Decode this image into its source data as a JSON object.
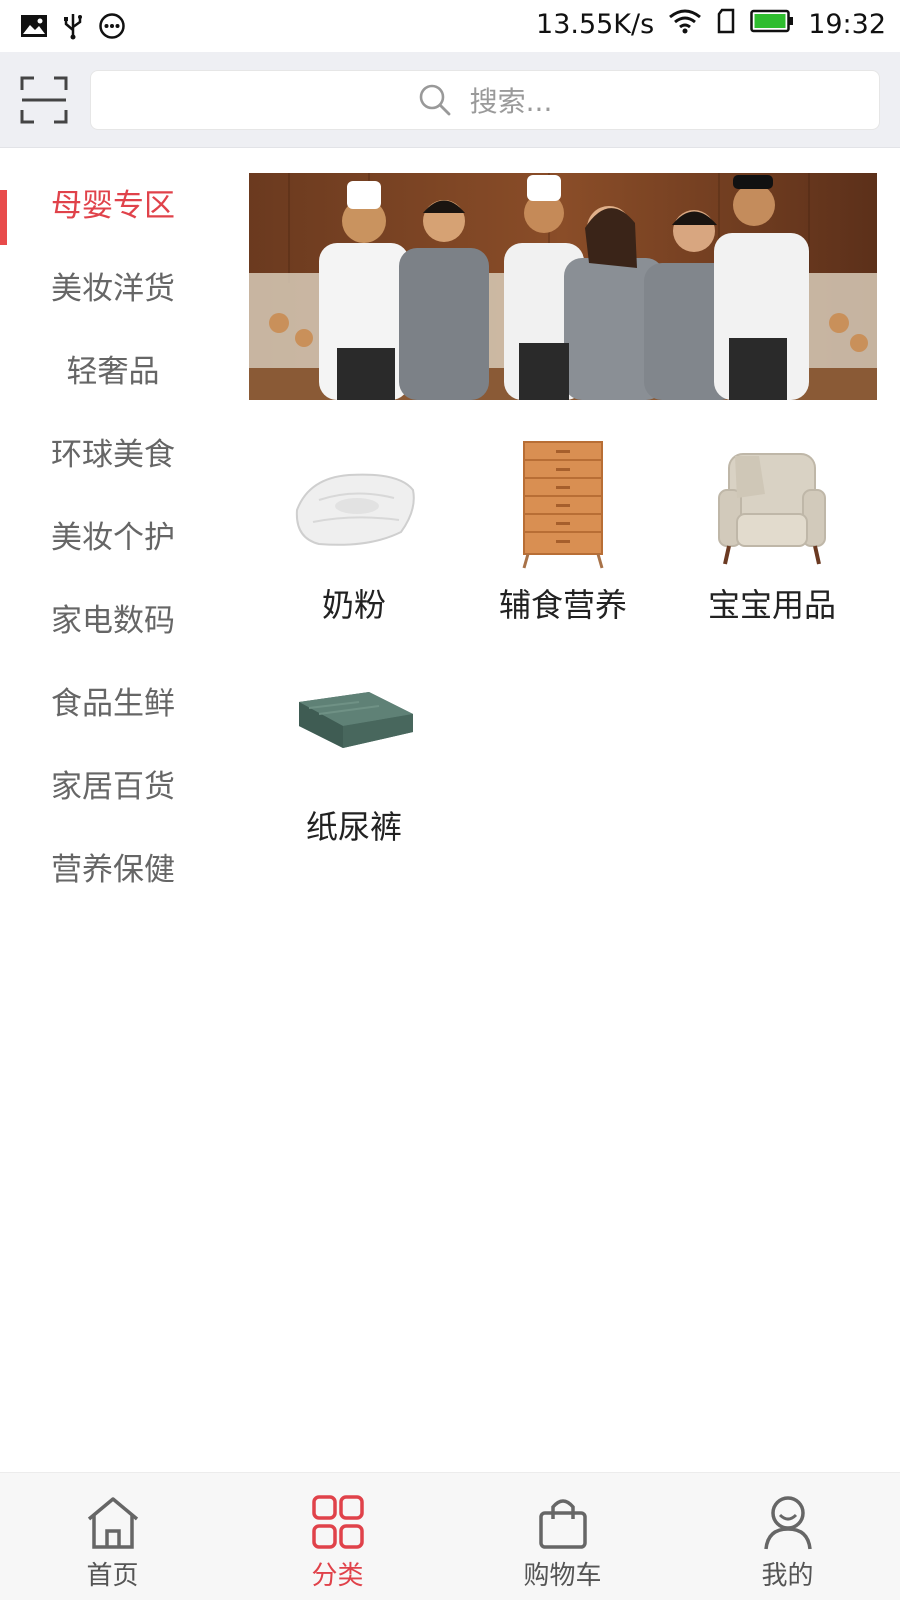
{
  "status_bar": {
    "left_icons": [
      "image-icon",
      "usb-icon",
      "more-dots-icon"
    ],
    "network_speed": "13.55K/s",
    "time": "19:32",
    "right_icons": [
      "wifi-icon",
      "sim-icon",
      "battery-icon"
    ],
    "battery_level": 1.0
  },
  "header": {
    "scan_icon": "scan-icon",
    "search_icon": "search-icon",
    "search_placeholder": "搜索..."
  },
  "sidebar": {
    "items": [
      {
        "label": "母婴专区",
        "active": true
      },
      {
        "label": "美妆洋货",
        "active": false
      },
      {
        "label": "轻奢品",
        "active": false
      },
      {
        "label": "环球美食",
        "active": false
      },
      {
        "label": "美妆个护",
        "active": false
      },
      {
        "label": "家电数码",
        "active": false
      },
      {
        "label": "食品生鲜",
        "active": false
      },
      {
        "label": "家居百货",
        "active": false
      },
      {
        "label": "营养保健",
        "active": false
      }
    ]
  },
  "banner": {
    "image": "banner-photo-chefs-and-staff"
  },
  "categories": [
    {
      "label": "奶粉",
      "icon": "pillow-icon"
    },
    {
      "label": "辅食营养",
      "icon": "dresser-icon"
    },
    {
      "label": "宝宝用品",
      "icon": "armchair-icon"
    },
    {
      "label": "纸尿裤",
      "icon": "folded-blanket-icon"
    }
  ],
  "bottom_nav": [
    {
      "label": "首页",
      "icon": "home-icon",
      "active": false
    },
    {
      "label": "分类",
      "icon": "category-grid-icon",
      "active": true
    },
    {
      "label": "购物车",
      "icon": "shopping-bag-icon",
      "active": false
    },
    {
      "label": "我的",
      "icon": "user-icon",
      "active": false
    }
  ],
  "colors": {
    "accent": "#e0424a",
    "header_bg": "#eeeff3",
    "sidebar_text": "#666666"
  }
}
